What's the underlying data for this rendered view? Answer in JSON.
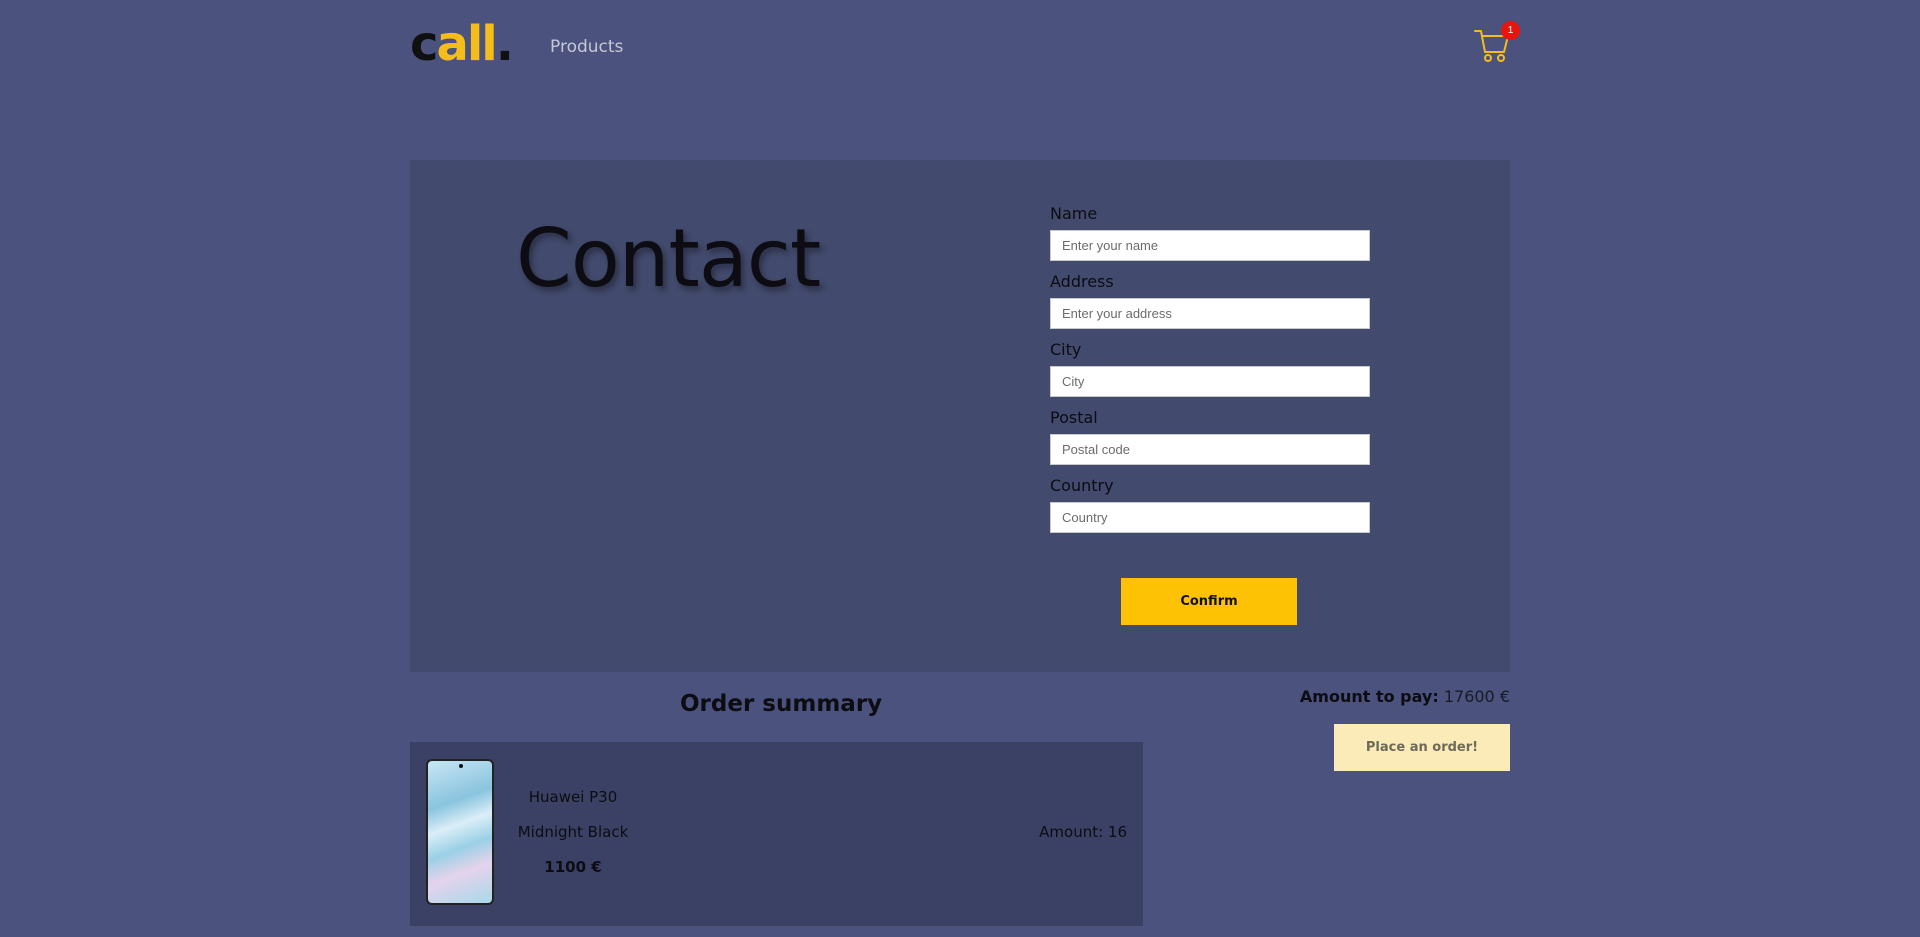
{
  "nav": {
    "logo": {
      "c": "c",
      "all": "all",
      "dot": "."
    },
    "products_link": "Products",
    "cart_count": "1"
  },
  "contact": {
    "title": "Contact",
    "fields": [
      {
        "label": "Name",
        "placeholder": "Enter your name"
      },
      {
        "label": "Address",
        "placeholder": "Enter your address"
      },
      {
        "label": "City",
        "placeholder": "City"
      },
      {
        "label": "Postal",
        "placeholder": "Postal code"
      },
      {
        "label": "Country",
        "placeholder": "Country"
      }
    ],
    "confirm_label": "Confirm"
  },
  "summary": {
    "title": "Order summary",
    "amount_to_pay_label": "Amount to pay:",
    "amount_to_pay_value": "17600 €",
    "place_order_label": "Place an order!",
    "items": [
      {
        "name": "Huawei P30",
        "variant": "Midnight Black",
        "price": "1100 €",
        "amount": "Amount: 16"
      }
    ]
  },
  "colors": {
    "background": "#4a527d",
    "panel": "#424a6d",
    "accent": "#fdc204",
    "badge": "#e8140e"
  }
}
